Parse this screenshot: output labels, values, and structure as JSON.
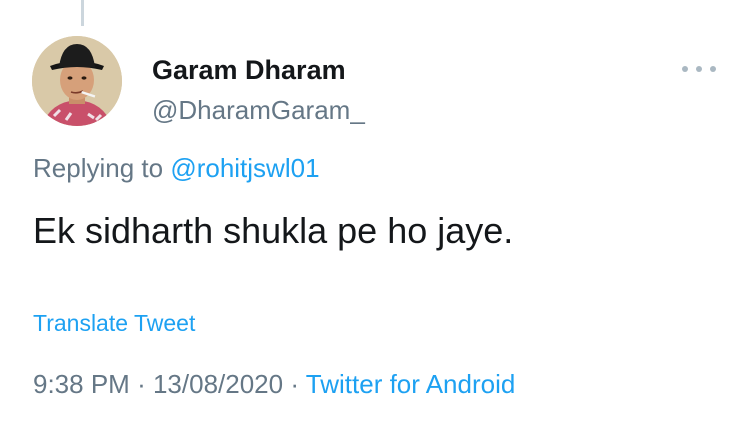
{
  "tweet": {
    "author_name": "Garam Dharam",
    "author_handle": "@DharamGaram_",
    "replying_prefix": "Replying to",
    "replying_to": "@rohitjswl01",
    "text": "Ek sidharth shukla pe ho jaye.",
    "translate_label": "Translate Tweet",
    "time": "9:38 PM",
    "date": "13/08/2020",
    "separator": "·",
    "source": "Twitter for Android"
  },
  "icons": {
    "more": "more-options-icon",
    "avatar": "profile-avatar"
  },
  "colors": {
    "link": "#1da1f2",
    "secondary_text": "#657786",
    "primary_text": "#14171a",
    "thread_line": "#ccd6dd"
  }
}
